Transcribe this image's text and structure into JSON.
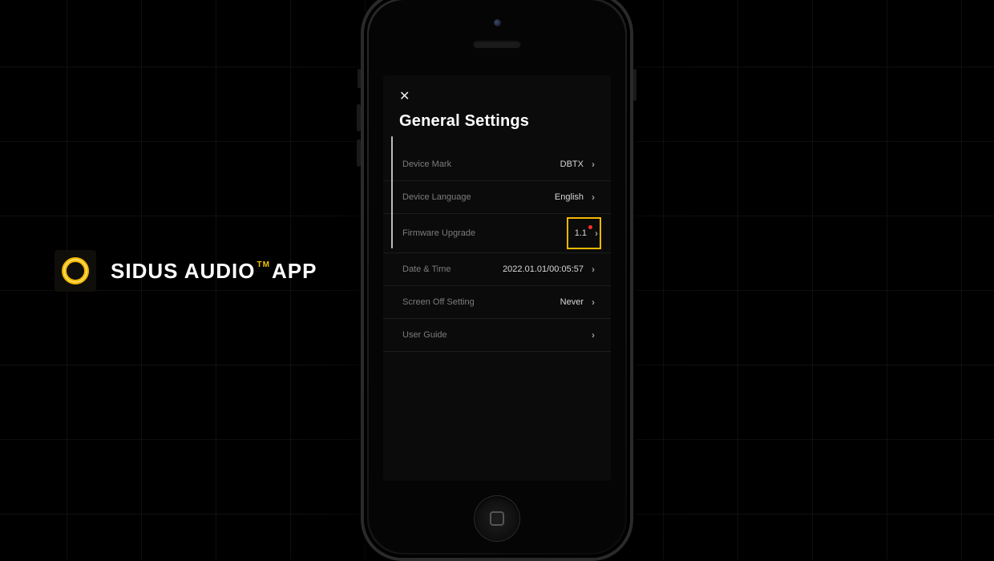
{
  "brand": {
    "name_1": "SIDUS AUDIO",
    "tm": "TM",
    "name_2": "APP",
    "ring_color_outer": "#f3b800",
    "ring_color_inner": "#000000"
  },
  "screen": {
    "title": "General Settings",
    "rows": [
      {
        "key": "device-mark",
        "label": "Device Mark",
        "value": "DBTX",
        "highlight": false,
        "badge": false
      },
      {
        "key": "device-language",
        "label": "Device Language",
        "value": "English",
        "highlight": false,
        "badge": false
      },
      {
        "key": "firmware-upgrade",
        "label": "Firmware Upgrade",
        "value": "1.1",
        "highlight": true,
        "badge": true
      },
      {
        "key": "date-time",
        "label": "Date & Time",
        "value": "2022.01.01/00:05:57",
        "highlight": false,
        "badge": false
      },
      {
        "key": "screen-off",
        "label": "Screen Off Setting",
        "value": "Never",
        "highlight": false,
        "badge": false
      },
      {
        "key": "user-guide",
        "label": "User Guide",
        "value": "",
        "highlight": false,
        "badge": false
      }
    ]
  }
}
